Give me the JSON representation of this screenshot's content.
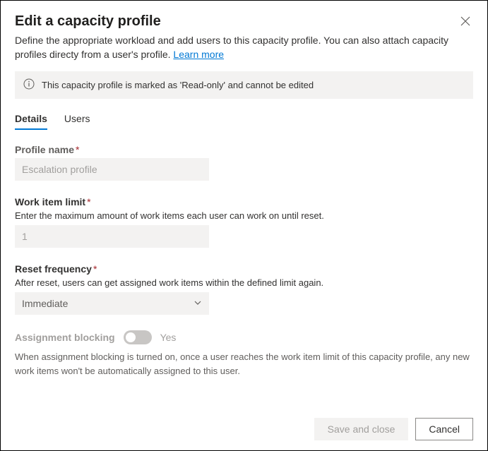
{
  "header": {
    "title": "Edit a capacity profile",
    "subtitle_pre": "Define the appropriate workload and add users to this capacity profile. You can also attach capacity profiles directy from a user's profile. ",
    "learn_more": "Learn more"
  },
  "info_bar": {
    "text": "This capacity profile is marked as 'Read-only' and cannot be edited"
  },
  "tabs": {
    "details": "Details",
    "users": "Users"
  },
  "fields": {
    "profile_name": {
      "label": "Profile name",
      "value": "Escalation profile"
    },
    "work_item_limit": {
      "label": "Work item limit",
      "help": "Enter the maximum amount of work items each user can work on until reset.",
      "value": "1"
    },
    "reset_frequency": {
      "label": "Reset frequency",
      "help": "After reset, users can get assigned work items within the defined limit again.",
      "value": "Immediate"
    },
    "assignment_blocking": {
      "label": "Assignment blocking",
      "state": "Yes",
      "desc": "When assignment blocking is turned on, once a user reaches the work item limit of this capacity profile, any new work items won't be automatically assigned to this user."
    }
  },
  "footer": {
    "save": "Save and close",
    "cancel": "Cancel"
  }
}
